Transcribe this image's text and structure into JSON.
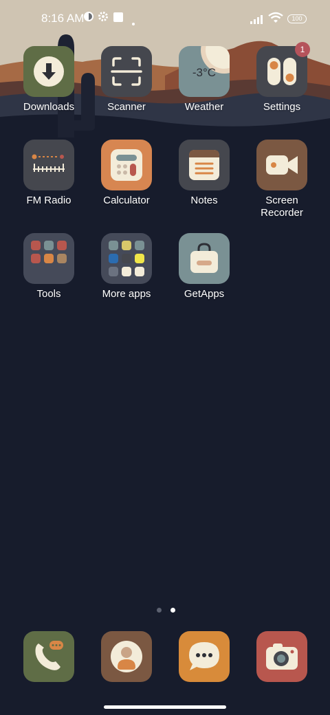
{
  "status": {
    "time": "8:16 AM",
    "battery": "100"
  },
  "apps": [
    {
      "label": "Downloads",
      "icon": "download-icon",
      "bg": "#5f6d46"
    },
    {
      "label": "Scanner",
      "icon": "scan-icon",
      "bg": "#45474e"
    },
    {
      "label": "Weather",
      "icon": "weather-icon",
      "bg": "#7a9194",
      "text": "-3°C"
    },
    {
      "label": "Settings",
      "icon": "settings-icon",
      "bg": "#45474e",
      "badge": "1"
    },
    {
      "label": "FM Radio",
      "icon": "radio-icon",
      "bg": "#45474e"
    },
    {
      "label": "Calculator",
      "icon": "calculator-icon",
      "bg": "#d78651"
    },
    {
      "label": "Notes",
      "icon": "notes-icon",
      "bg": "#45474e"
    },
    {
      "label": "Screen Recorder",
      "icon": "video-camera-icon",
      "bg": "#7b5842"
    },
    {
      "label": "Tools",
      "icon": "folder-icon",
      "bg": "#454a59"
    },
    {
      "label": "More apps",
      "icon": "folder-icon",
      "bg": "#454a59"
    },
    {
      "label": "GetApps",
      "icon": "shopping-bag-icon",
      "bg": "#7a9194"
    }
  ],
  "dock": [
    {
      "icon": "phone-icon",
      "bg": "#5f6d46"
    },
    {
      "icon": "contacts-icon",
      "bg": "#7b5842"
    },
    {
      "icon": "messages-icon",
      "bg": "#d78b3a"
    },
    {
      "icon": "camera-icon",
      "bg": "#b8574e"
    }
  ],
  "colors": {
    "background": "#171c2c",
    "accent_cream": "#f3ecd9",
    "accent_orange": "#d88646",
    "badge": "#b5535b"
  }
}
